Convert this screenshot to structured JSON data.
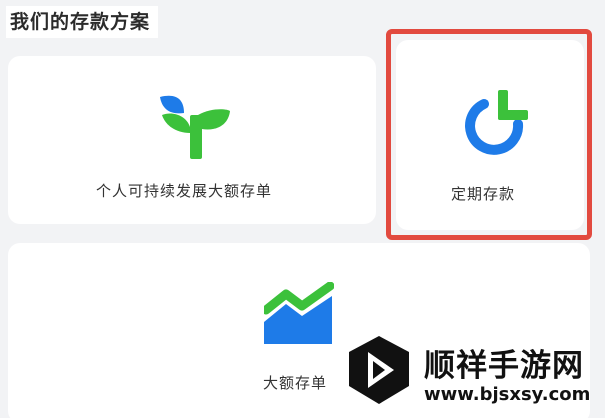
{
  "section": {
    "title": "我们的存款方案"
  },
  "products": [
    {
      "label": "个人可持续发展大额存单",
      "icon": "sprout-icon"
    },
    {
      "label": "定期存款",
      "icon": "refresh-plus-icon"
    },
    {
      "label": "大额存单",
      "icon": "growth-chart-icon"
    }
  ],
  "watermark": {
    "brand": "顺祥手游网",
    "url": "www.bjsxsy.com"
  },
  "colors": {
    "green": "#3cc13b",
    "blue": "#1e7be8",
    "highlight": "#e24a3f",
    "card": "#ffffff",
    "background": "#f2f3f5"
  }
}
